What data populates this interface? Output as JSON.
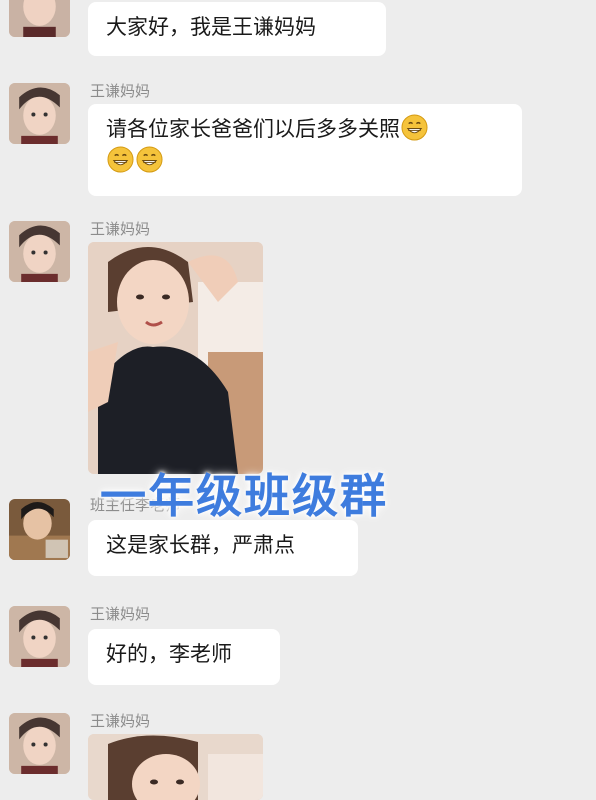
{
  "chat": {
    "messages": [
      {
        "sender": "",
        "text": "大家好，我是王谦妈妈"
      },
      {
        "sender": "王谦妈妈",
        "text": "请各位家长爸爸们以后多多关照"
      },
      {
        "sender": "王谦妈妈",
        "type": "image"
      },
      {
        "sender": "班主任李老师",
        "text": "这是家长群，严肃点"
      },
      {
        "sender": "王谦妈妈",
        "text": "好的，李老师"
      },
      {
        "sender": "王谦妈妈",
        "type": "image"
      }
    ],
    "emoji_icon": "grinning-face-icon"
  },
  "overlay": {
    "title": "一年级班级群"
  },
  "colors": {
    "background": "#ededed",
    "bubble": "#ffffff",
    "overlay_text": "#3e7cde"
  }
}
